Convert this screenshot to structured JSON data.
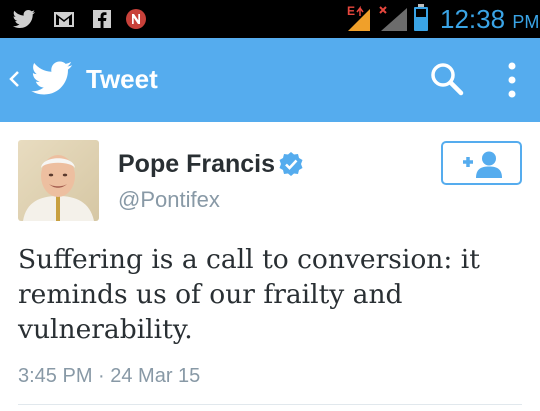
{
  "status_bar": {
    "notification_icons": [
      "twitter-icon",
      "gmail-icon",
      "facebook-icon",
      "news-icon"
    ],
    "signal_icons": [
      "edge-signal-icon",
      "signal-bars-icon",
      "battery-icon"
    ],
    "edge_label": "E",
    "time": "12:38",
    "ampm": "PM",
    "accent": "#3aa4e6"
  },
  "action_bar": {
    "title": "Tweet",
    "background": "#55acee",
    "icons": [
      "back-icon",
      "twitter-bird-icon",
      "search-icon",
      "overflow-menu-icon"
    ]
  },
  "tweet": {
    "author_name": "Pope Francis",
    "handle": "@Pontifex",
    "verified": true,
    "text": "Suffering is a call to conversion: it reminds us of our frailty and vulnerability.",
    "timestamp": "3:45 PM · 24 Mar 15",
    "follow_button_icon": "add-user-icon"
  }
}
